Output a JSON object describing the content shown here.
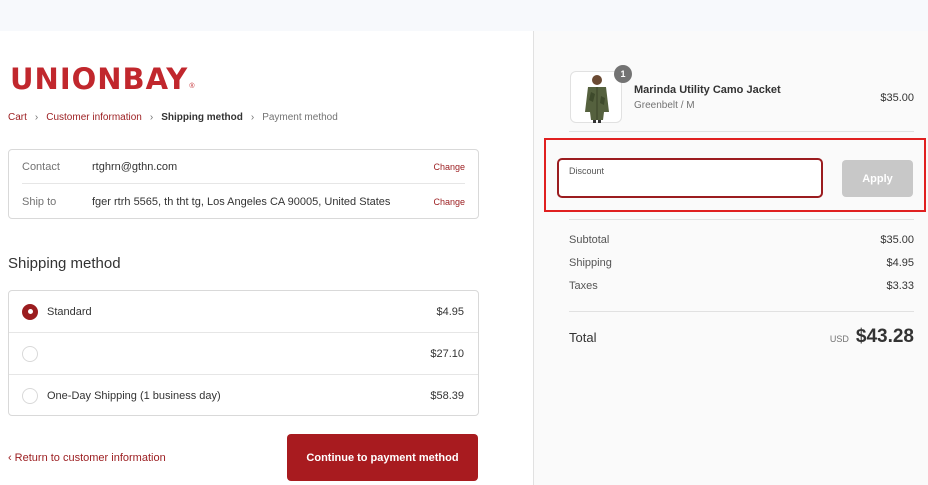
{
  "brand": {
    "logo_text": "UNIONBAY",
    "logo_mark": "®"
  },
  "breadcrumb": {
    "cart": "Cart",
    "customer_information": "Customer information",
    "shipping_method": "Shipping method",
    "payment_method": "Payment method"
  },
  "review": {
    "contact_label": "Contact",
    "contact_value": "rtghrn@gthn.com",
    "ship_to_label": "Ship to",
    "ship_to_value": "fger rtrh 5565, th tht tg, Los Angeles CA 90005, United States",
    "change_label": "Change"
  },
  "shipping": {
    "title": "Shipping method",
    "options": [
      {
        "label": "Standard",
        "price": "$4.95",
        "selected": true
      },
      {
        "label": "",
        "price": "$27.10",
        "selected": false
      },
      {
        "label": "One-Day Shipping (1 business day)",
        "price": "$58.39",
        "selected": false
      }
    ]
  },
  "footer": {
    "return_label": "Return to customer information",
    "continue_label": "Continue to payment method"
  },
  "order": {
    "product": {
      "name": "Marinda Utility Camo Jacket",
      "variant": "Greenbelt / M",
      "price": "$35.00",
      "quantity": "1"
    },
    "discount": {
      "placeholder": "Discount",
      "apply_label": "Apply"
    },
    "subtotal_label": "Subtotal",
    "subtotal_value": "$35.00",
    "shipping_label": "Shipping",
    "shipping_value": "$4.95",
    "taxes_label": "Taxes",
    "taxes_value": "$3.33",
    "total_label": "Total",
    "currency": "USD",
    "total_value": "$43.28"
  },
  "colors": {
    "brand_red": "#c1272d",
    "accent": "#9b1c1f",
    "button": "#a81b1f",
    "highlight_frame": "#e02020"
  }
}
